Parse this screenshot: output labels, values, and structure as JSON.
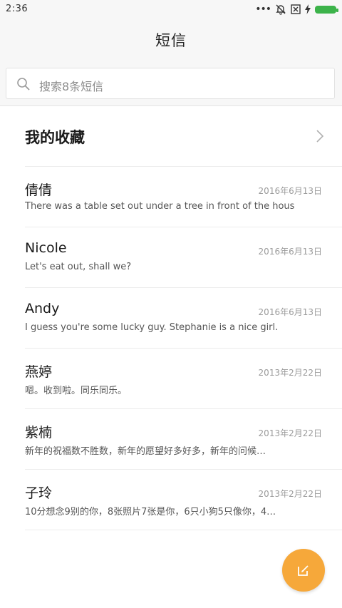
{
  "status_bar": {
    "time": "2:36",
    "battery_color": "#3cb34a"
  },
  "header": {
    "title": "短信"
  },
  "search": {
    "placeholder": "搜索8条短信"
  },
  "favorites": {
    "label": "我的收藏"
  },
  "messages": [
    {
      "name": "倩倩",
      "date": "2016年6月13日",
      "preview": "There was a table set out under a tree in front of the hous"
    },
    {
      "name": "Nicole",
      "date": "2016年6月13日",
      "preview": "Let's eat out, shall we?"
    },
    {
      "name": "Andy",
      "date": "2016年6月13日",
      "preview": "I guess you're some lucky guy. Stephanie is a nice girl."
    },
    {
      "name": "燕婷",
      "date": "2013年2月22日",
      "preview": "嗯。收到啦。同乐同乐。"
    },
    {
      "name": "紫楠",
      "date": "2013年2月22日",
      "preview": "新年的祝福数不胜数，新年的愿望好多好多，新年的问候…"
    },
    {
      "name": "子玲",
      "date": "2013年2月22日",
      "preview": "10分想念9别的你，8张照片7张是你，6只小狗5只像你，4…"
    }
  ],
  "fab": {
    "icon": "compose-icon",
    "color": "#f6a83a"
  }
}
